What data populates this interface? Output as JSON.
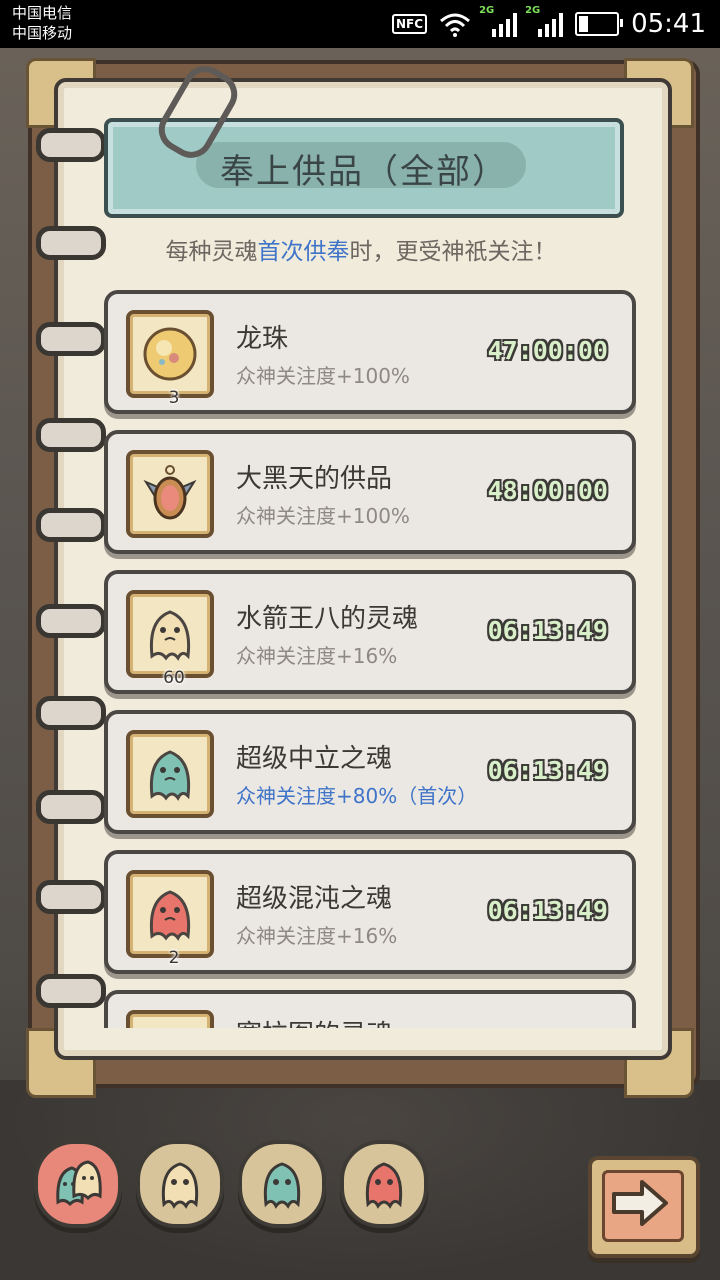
{
  "status_bar": {
    "carrier_1": "中国电信",
    "carrier_2": "中国移动",
    "nfc": "NFC",
    "network_1": "2G",
    "network_2": "2G",
    "time": "05:41"
  },
  "panel": {
    "title": "奉上供品（全部）",
    "subtitle_pre": "每种灵魂",
    "subtitle_highlight": "首次供奉",
    "subtitle_post": "时，更受神祇关注！"
  },
  "offerings": [
    {
      "name": "龙珠",
      "desc": "众神关注度+100%",
      "time": "47:00:00",
      "count": "3",
      "first": false,
      "icon": "dragon-orb-icon",
      "color": "#e9c96b"
    },
    {
      "name": "大黑天的供品",
      "desc": "众神关注度+100%",
      "time": "48:00:00",
      "count": "",
      "first": false,
      "icon": "amulet-icon",
      "color": "#e98a7c"
    },
    {
      "name": "水箭王八的灵魂",
      "desc": "众神关注度+16%",
      "time": "06:13:49",
      "count": "60",
      "first": false,
      "icon": "ghost-cream-icon",
      "color": "#f2dfb4"
    },
    {
      "name": "超级中立之魂",
      "desc": "众神关注度+80%（首次）",
      "time": "06:13:49",
      "count": "",
      "first": true,
      "icon": "ghost-teal-icon",
      "color": "#7fc2b3"
    },
    {
      "name": "超级混沌之魂",
      "desc": "众神关注度+16%",
      "time": "06:13:49",
      "count": "2",
      "first": false,
      "icon": "ghost-red-icon",
      "color": "#e8756c"
    },
    {
      "name": "塞拉图的灵魂",
      "desc": "",
      "time": "",
      "count": "",
      "first": false,
      "icon": "ghost-cream-icon",
      "color": "#f2dfb4"
    }
  ],
  "filter_tabs": [
    {
      "name": "all",
      "icon": "ghost-group-icon",
      "color": "#e8887a",
      "active": true
    },
    {
      "name": "cream",
      "icon": "ghost-cream-icon",
      "color": "#f2dfb4",
      "active": false
    },
    {
      "name": "teal",
      "icon": "ghost-teal-icon",
      "color": "#7fc2b3",
      "active": false
    },
    {
      "name": "red",
      "icon": "ghost-red-icon",
      "color": "#e8756c",
      "active": false
    }
  ],
  "next_button_icon": "arrow-right-icon"
}
